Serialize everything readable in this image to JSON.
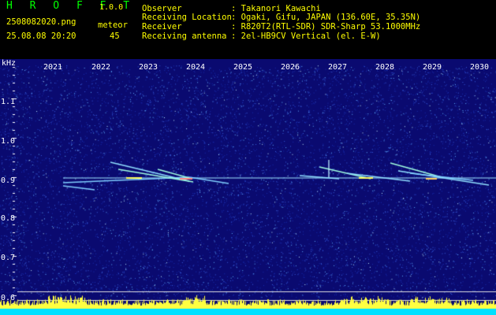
{
  "header": {
    "app_title": "H R O F F T",
    "version": "1.0.0",
    "filename": "2508082020.png",
    "datetime": "25.08.08 20:20",
    "meteor_label": "meteor",
    "meteor_count": "45",
    "info": [
      {
        "label": "Observer",
        "value": ": Takanori Kawachi"
      },
      {
        "label": "Receiving Location",
        "value": ": Ogaki, Gifu, JAPAN (136.60E, 35.35N)"
      },
      {
        "label": "Receiver",
        "value": ": R820T2(RTL-SDR) SDR-Sharp 53.1000MHz"
      },
      {
        "label": "Receiving antenna",
        "value": ": 2el-HB9CV Vertical (el. E-W)"
      }
    ]
  },
  "axis": {
    "y_unit": "kHz",
    "y_ticks": [
      "1.1",
      "1.0",
      "0.9",
      "0.8",
      "0.7",
      "0.6"
    ],
    "x_ticks": [
      "2021",
      "2022",
      "2023",
      "2024",
      "2025",
      "2026",
      "2027",
      "2028",
      "2029",
      "2030"
    ]
  },
  "colors": {
    "background": "#000000",
    "plot_bg": "#0a0a70",
    "title_green": "#00ff00",
    "header_yellow": "#ffff00",
    "text_white": "#ffffff",
    "noise_floor_cyan": "#00e0ff",
    "noise_peaks_yellow": "#ffff40"
  }
}
